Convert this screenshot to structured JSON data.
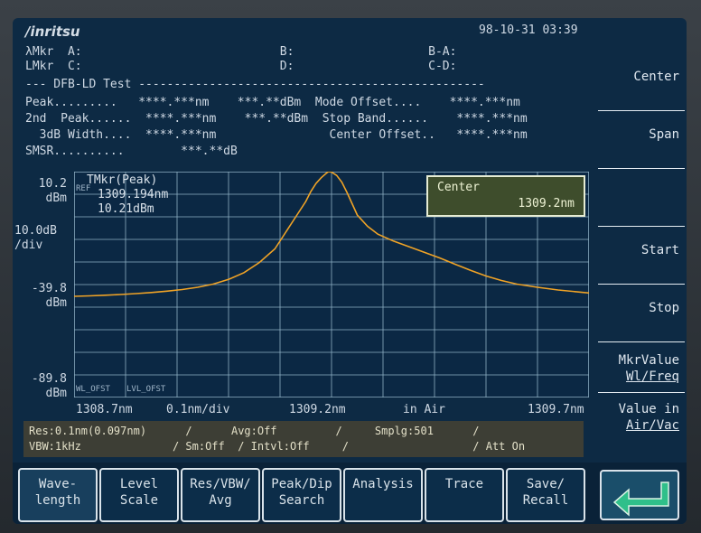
{
  "header": {
    "brand": "/inritsu",
    "datetime": "98-10-31 03:39",
    "row1": "λMkr  A:                            B:                   B-A:",
    "row2": "LMkr  C:                            D:                   C-D:",
    "row3": "--- DFB-LD Test -------------------------------------------------",
    "row4": "Peak.........   ****.***nm    ***.**dBm  Mode Offset....    ****.***nm",
    "row5": "2nd  Peak......  ****.***nm    ***.**dBm  Stop Band......    ****.***nm",
    "row6": "  3dB Width....  ****.***nm                Center Offset..   ****.***nm",
    "row7": "SMSR..........        ***.**dB"
  },
  "softkeys": [
    {
      "label": "Center"
    },
    {
      "label": "Span"
    },
    {
      "label": ""
    },
    {
      "label": "Start"
    },
    {
      "label": "Stop"
    },
    {
      "label": "MkrValue",
      "label2": "Wl/Freq"
    },
    {
      "label": "Value in",
      "label2": "Air/Vac"
    }
  ],
  "yaxis": {
    "top": "10.2",
    "top_unit": "dBm",
    "scale": "10.0dB",
    "scale_unit": "/div",
    "mid": "-39.8",
    "mid_unit": "dBm",
    "bottom": "-89.8",
    "bottom_unit": "dBm"
  },
  "marker": {
    "label": "TMkr(Peak)",
    "wavelength": "1309.194nm",
    "level": "10.21dBm"
  },
  "center_box": {
    "title": "Center",
    "value": "1309.2nm"
  },
  "plot_labels": {
    "ref": "REF",
    "wl_ofst": "WL_OFST",
    "lvl_ofst": "LVL_OFST"
  },
  "xaxis": {
    "start": "1308.7nm",
    "div": "0.1nm/div",
    "center": "1309.2nm",
    "medium": "in Air",
    "stop": "1309.7nm"
  },
  "status": {
    "line1": "Res:0.1nm(0.097nm)      /      Avg:Off         /     Smplg:501      /",
    "line2": "VBW:1kHz              / Sm:Off  / Intvl:Off     /                   / Att On"
  },
  "tabs": [
    {
      "label": "Wave-",
      "label2": "length",
      "selected": true
    },
    {
      "label": "Level",
      "label2": "Scale"
    },
    {
      "label": "Res/VBW/",
      "label2": "Avg"
    },
    {
      "label": "Peak/Dip",
      "label2": "Search"
    },
    {
      "label": "Analysis",
      "label2": ""
    },
    {
      "label": "Trace",
      "label2": ""
    },
    {
      "label": "Save/",
      "label2": "Recall"
    }
  ],
  "colors": {
    "trace": "#f0a326",
    "grid": "#8fb0c4",
    "screen": "#0d2a44"
  },
  "trace_points": [
    [
      1308.7,
      -45.0
    ],
    [
      1308.73,
      -44.8
    ],
    [
      1308.76,
      -44.5
    ],
    [
      1308.79,
      -44.2
    ],
    [
      1308.82,
      -43.8
    ],
    [
      1308.85,
      -43.3
    ],
    [
      1308.88,
      -42.7
    ],
    [
      1308.91,
      -42.0
    ],
    [
      1308.94,
      -41.0
    ],
    [
      1308.97,
      -39.6
    ],
    [
      1309.0,
      -37.5
    ],
    [
      1309.03,
      -34.5
    ],
    [
      1309.06,
      -30.0
    ],
    [
      1309.09,
      -24.0
    ],
    [
      1309.11,
      -17.0
    ],
    [
      1309.13,
      -10.0
    ],
    [
      1309.15,
      -3.0
    ],
    [
      1309.16,
      1.5
    ],
    [
      1309.17,
      5.0
    ],
    [
      1309.18,
      7.5
    ],
    [
      1309.19,
      9.5
    ],
    [
      1309.194,
      10.21
    ],
    [
      1309.2,
      10.0
    ],
    [
      1309.21,
      8.5
    ],
    [
      1309.22,
      5.5
    ],
    [
      1309.23,
      1.0
    ],
    [
      1309.24,
      -4.0
    ],
    [
      1309.25,
      -9.0
    ],
    [
      1309.27,
      -14.0
    ],
    [
      1309.29,
      -17.5
    ],
    [
      1309.32,
      -20.5
    ],
    [
      1309.35,
      -23.0
    ],
    [
      1309.38,
      -25.5
    ],
    [
      1309.41,
      -28.0
    ],
    [
      1309.44,
      -30.8
    ],
    [
      1309.47,
      -33.5
    ],
    [
      1309.5,
      -36.0
    ],
    [
      1309.53,
      -38.0
    ],
    [
      1309.56,
      -39.6
    ],
    [
      1309.6,
      -41.0
    ],
    [
      1309.64,
      -42.2
    ],
    [
      1309.7,
      -43.5
    ]
  ]
}
